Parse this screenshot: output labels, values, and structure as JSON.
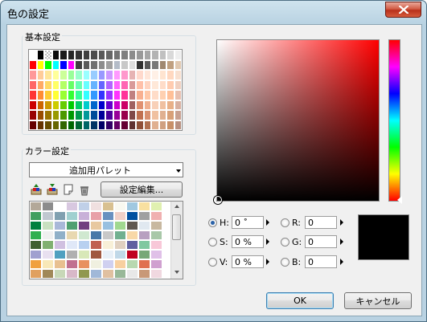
{
  "window": {
    "title": "色の設定"
  },
  "basic": {
    "label": "基本設定",
    "colors": [
      "#ffffff",
      "#000000",
      "#000000",
      "#0d0d0d",
      "#1a1a1a",
      "#262626",
      "#333333",
      "#404040",
      "#4d4d4d",
      "#595959",
      "#666666",
      "#737373",
      "#808080",
      "#8c8c8c",
      "#999999",
      "#a6a6a6",
      "#b3b3b3",
      "#c0c0c0",
      "#d9d9d9",
      "#eeeeee",
      "#ff0000",
      "#ffff00",
      "#00ff00",
      "#00ffff",
      "#0000ff",
      "#ff00ff",
      "#404040",
      "#5a5a5a",
      "#707070",
      "#8c8c8c",
      "#a0a0a0",
      "#b4bcc8",
      "#c8c8c8",
      "#dcdcdc",
      "#303030",
      "#585858",
      "#787878",
      "#a08870",
      "#c0a080",
      "#e0c8b0",
      "#ff9999",
      "#ffcc99",
      "#ffe699",
      "#ffff99",
      "#ccff99",
      "#99ff99",
      "#99ffcc",
      "#99ffff",
      "#99ccff",
      "#9999ff",
      "#cc99ff",
      "#ff99ff",
      "#ff99cc",
      "#e6b3b3",
      "#ffd9cc",
      "#ffe6d9",
      "#fff0e6",
      "#ffe4d0",
      "#ffd8c0",
      "#f8e0d0",
      "#ff6666",
      "#ffaa66",
      "#ffd966",
      "#ffff66",
      "#b3ff66",
      "#66ff66",
      "#66ffb3",
      "#66ffff",
      "#66b3ff",
      "#6666ff",
      "#b366ff",
      "#ff66ff",
      "#ff66b3",
      "#d99999",
      "#ffc0a8",
      "#ffd4c0",
      "#ffe8d8",
      "#ffdcc8",
      "#ffccb0",
      "#f0d0c0",
      "#ff3333",
      "#ff8c33",
      "#ffcc33",
      "#ffff33",
      "#99ff33",
      "#33ff33",
      "#33ff99",
      "#33ffff",
      "#3399ff",
      "#3333ff",
      "#9933ff",
      "#ff33ff",
      "#ff3399",
      "#c08080",
      "#f8b090",
      "#ffc8a8",
      "#ffdcc8",
      "#ffd0b0",
      "#ffc098",
      "#e8c0b0",
      "#cc0000",
      "#cc6600",
      "#cc9900",
      "#cccc00",
      "#66cc00",
      "#00cc00",
      "#00cc66",
      "#00cccc",
      "#0066cc",
      "#0000cc",
      "#6600cc",
      "#cc00cc",
      "#cc0066",
      "#a06060",
      "#e09070",
      "#f0b090",
      "#f8d0b8",
      "#f0c0a0",
      "#e8b088",
      "#d8b0a0",
      "#990000",
      "#994c00",
      "#997300",
      "#999900",
      "#4c9900",
      "#009900",
      "#00994c",
      "#009999",
      "#004c99",
      "#000099",
      "#4c0099",
      "#990099",
      "#99004c",
      "#804848",
      "#c07050",
      "#d89070",
      "#f0c0a0",
      "#e0b090",
      "#d8a078",
      "#c8a090",
      "#660000",
      "#663300",
      "#664c00",
      "#666600",
      "#336600",
      "#006600",
      "#006633",
      "#006666",
      "#003366",
      "#000066",
      "#330066",
      "#660066",
      "#660033",
      "#603030",
      "#905038",
      "#b07050",
      "#e0b090",
      "#d0a080",
      "#c89068",
      "#b89080"
    ]
  },
  "custom": {
    "label": "カラー設定",
    "palette_select": "追加用パレット",
    "edit_button": "設定編集...",
    "toolbar_icons": [
      "load-palette-icon",
      "save-palette-icon",
      "new-palette-icon",
      "trash-icon"
    ],
    "colors": [
      "#b3a898",
      "#8c8c8c",
      "#ffffff",
      "#d8c8e0",
      "#c0d0e8",
      "#f0e0e0",
      "#d8c090",
      "#f8f8f0",
      "#a0c8e0",
      "#f8e0a0",
      "#e0f0b0",
      "#40a060",
      "#c0c8d0",
      "#80a0b0",
      "#a0d0d0",
      "#c8b0d8",
      "#e8a0a8",
      "#6890c0",
      "#f0d0c8",
      "#0050a0",
      "#a0a0a0",
      "#f0b0b0",
      "#008040",
      "#c8e0c0",
      "#a8b8d8",
      "#50a070",
      "#704080",
      "#e8c8a0",
      "#98c0e0",
      "#a0d890",
      "#605850",
      "#e0e8f0",
      "#c8b8a0",
      "#30b050",
      "#f0f0f0",
      "#90b0c8",
      "#e8d8b0",
      "#d0e8d0",
      "#4878a8",
      "#c8c8c8",
      "#70b090",
      "#f8d8a8",
      "#b8a0c0",
      "#a8c8a8",
      "#406030",
      "#80b070",
      "#d0c0e0",
      "#e0e8f8",
      "#b8d0f0",
      "#c06050",
      "#f8f0d8",
      "#e0d0c0",
      "#6060a0",
      "#80c8a0",
      "#f8c8d8",
      "#a0a0d0",
      "#e8e0f0",
      "#50a0c0",
      "#b0b0b0",
      "#d8e8b8",
      "#a05840",
      "#e8f0f8",
      "#c0d8e8",
      "#c00020",
      "#78a878",
      "#e0c0e8",
      "#f0a040",
      "#f8e8b8",
      "#e8c090",
      "#c07090",
      "#e89060",
      "#f0f0e0",
      "#d0d0f0",
      "#f8d0a0",
      "#b8d8b0",
      "#e07050",
      "#d0a0d0",
      "#e0a060",
      "#a08858",
      "#c8d8b8",
      "#d8b8c8",
      "#909850",
      "#a0b8d8",
      "#e0c0a0",
      "#98b898",
      "#e8e8e8",
      "#c89878",
      "#f0d8e0"
    ]
  },
  "controls": {
    "h": {
      "label": "H:",
      "value": "0 ˚",
      "selected": true
    },
    "s": {
      "label": "S:",
      "value": "0 %",
      "selected": false
    },
    "v": {
      "label": "V:",
      "value": "0 %",
      "selected": false
    },
    "r": {
      "label": "R:",
      "value": "0",
      "selected": false
    },
    "g": {
      "label": "G:",
      "value": "0",
      "selected": false
    },
    "b": {
      "label": "B:",
      "value": "0",
      "selected": false
    }
  },
  "preview_color": "#000000",
  "buttons": {
    "ok": "OK",
    "cancel": "キャンセル"
  }
}
